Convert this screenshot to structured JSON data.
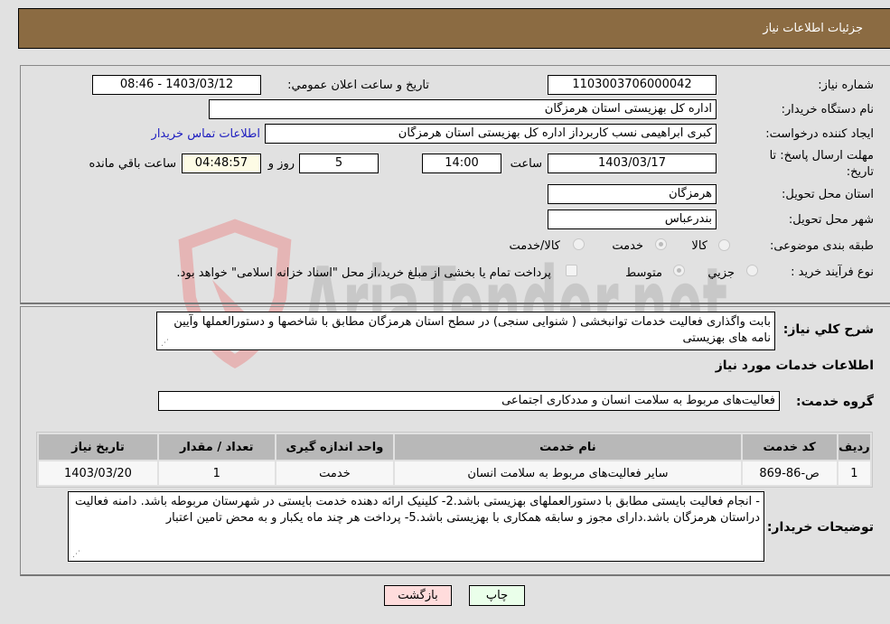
{
  "header": {
    "title": "جزئیات اطلاعات نیاز"
  },
  "fields": {
    "need_number_label": "شماره نیاز:",
    "need_number": "1103003706000042",
    "announce_label": "تاریخ و ساعت اعلان عمومي:",
    "announce_value": "1403/03/12 - 08:46",
    "buyer_org_label": "نام دستگاه خريدار:",
    "buyer_org": "اداره کل بهزیستی استان هرمزگان",
    "creator_label": "ایجاد کننده درخواست:",
    "creator": "کبری  ابراهیمی نسب کاربرداز اداره کل بهزیستی استان هرمزگان",
    "contact_link": "اطلاعات تماس خریدار",
    "deadline_label_line1": "مهلت ارسال پاسخ: تا",
    "deadline_label_line2": "تاریخ:",
    "deadline_date": "1403/03/17",
    "time_label": "ساعت",
    "deadline_time": "14:00",
    "days_value": "5",
    "days_label": "روز و",
    "remaining_time": "04:48:57",
    "remaining_label": "ساعت باقي مانده",
    "province_label": "استان محل تحویل:",
    "province": "هرمزگان",
    "city_label": "شهر محل تحویل:",
    "city": "بندرعباس",
    "category_label": "طبقه بندی موضوعی:",
    "category_options": [
      {
        "label": "کالا",
        "checked": false
      },
      {
        "label": "خدمت",
        "checked": true
      },
      {
        "label": "کالا/خدمت",
        "checked": false
      }
    ],
    "process_label": "نوع فرآیند خرید :",
    "process_options": [
      {
        "label": "جزيي",
        "checked": false
      },
      {
        "label": "متوسط",
        "checked": true
      }
    ],
    "payment_note": "پرداخت تمام یا بخشی از مبلغ خرید،از محل \"اسناد خزانه اسلامی\" خواهد بود."
  },
  "description": {
    "label": "شرح كلي نياز:",
    "text": "بابت واگذاری فعالیت خدمات توانبخشی ( شنوایی سنجی)  در سطح استان هرمزگان مطابق با شاخصها و دستورالعملها وآیین نامه های بهزیستی"
  },
  "services_section": {
    "title": "اطلاعات خدمات مورد نياز",
    "group_label": "گروه خدمت:",
    "group_value": "فعالیت‌های مربوط به سلامت انسان و مددکاری اجتماعی"
  },
  "table": {
    "headers": [
      "رديف",
      "کد خدمت",
      "نام خدمت",
      "واحد اندازه گيری",
      "تعداد / مقدار",
      "تاریخ نياز"
    ],
    "rows": [
      [
        "1",
        "ص-86-869",
        "سایر فعالیت‌های مربوط به سلامت انسان",
        "خدمت",
        "1",
        "1403/03/20"
      ]
    ]
  },
  "buyer_notes": {
    "label": "توضيحات خريدار:",
    "text": "- انجام فعالیت بایستی مطابق با دستورالعملهای بهزیستی باشد.2- کلینیک ارائه دهنده  خدمت بایستی در شهرستان مربوطه باشد. دامنه فعالیت دراستان هرمزگان باشد.دارای مجوز و سابقه همکاری با بهزیستی باشد.5- پرداخت هر چند ماه یکبار و به محض تامین اعتبار"
  },
  "buttons": {
    "print": "چاپ",
    "back": "بازگشت"
  },
  "watermark": {
    "text": "AriaTender.net"
  },
  "colors": {
    "header_bg": "#8b6b42",
    "print_bg": "#eaffea",
    "back_bg": "#ffdcdc",
    "link": "#2020c0"
  }
}
